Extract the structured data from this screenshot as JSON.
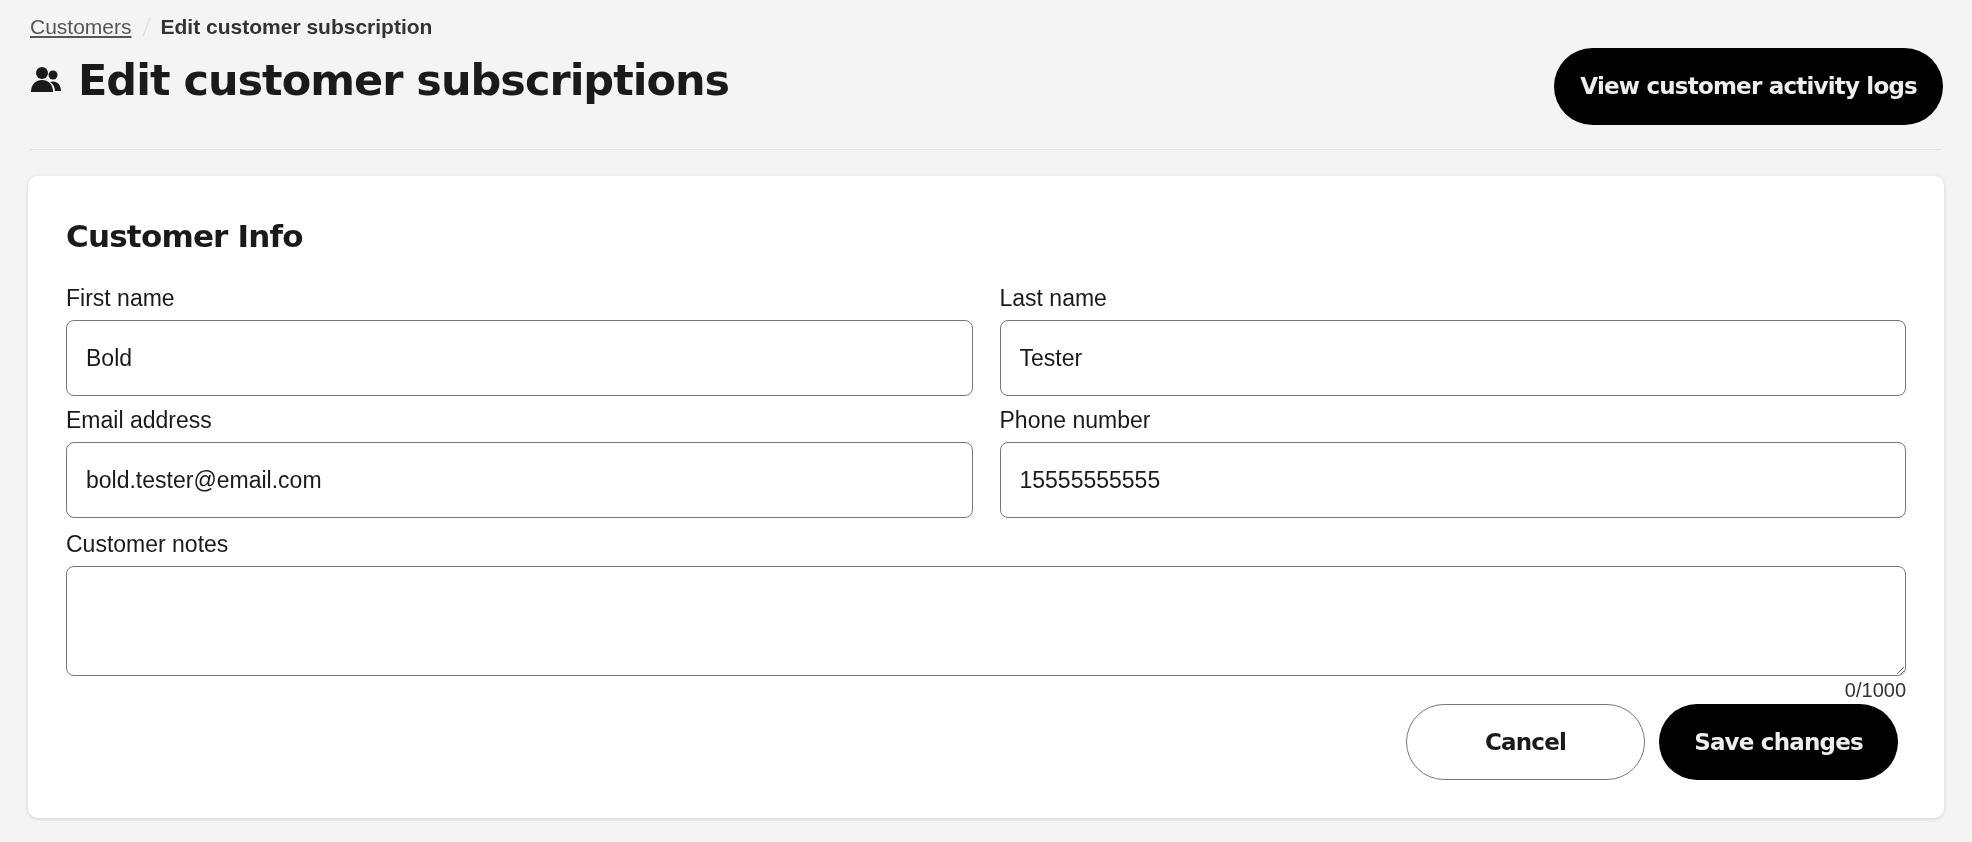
{
  "breadcrumb": [
    {
      "label": "Customers",
      "kind": "link"
    },
    {
      "label": "Edit customer subscription",
      "kind": "current"
    }
  ],
  "page_title": "Edit customer subscriptions",
  "header_button": "View customer activity logs",
  "card": {
    "title": "Customer Info",
    "fields": [
      {
        "label": "First name",
        "value": "Bold"
      },
      {
        "label": "Last name",
        "value": "Tester"
      },
      {
        "label": "Email address",
        "value": "bold.tester@email.com"
      },
      {
        "label": "Phone number",
        "value": "15555555555"
      }
    ],
    "notes": {
      "label": "Customer notes",
      "counter": "0/1000"
    },
    "buttons": [
      {
        "label": "Cancel",
        "kind": "secondary"
      },
      {
        "label": "Save changes",
        "kind": "primary"
      }
    ]
  }
}
